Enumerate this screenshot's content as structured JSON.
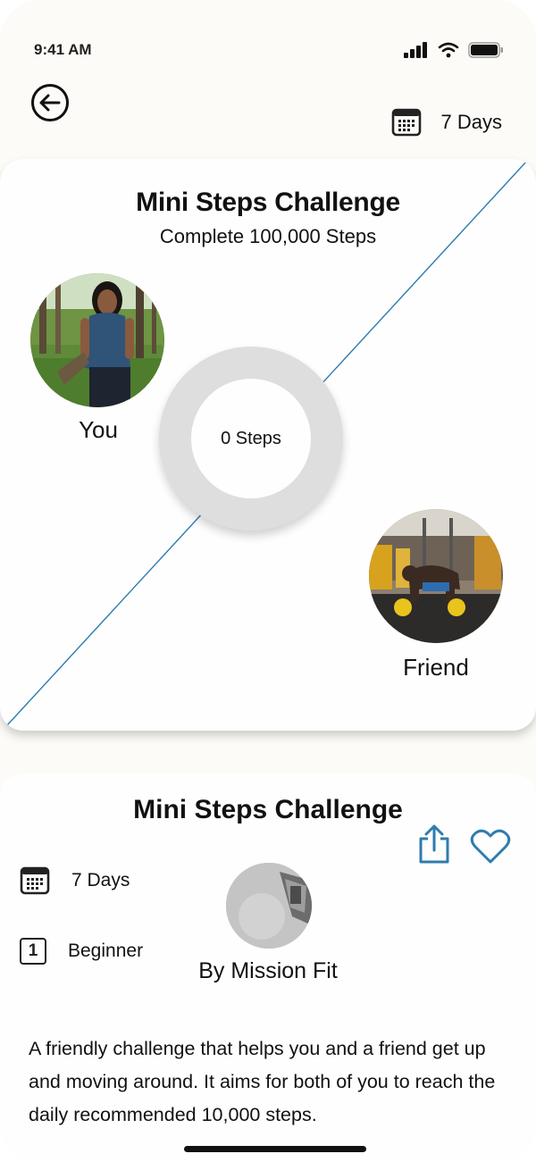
{
  "status_bar": {
    "time": "9:41 AM"
  },
  "header": {
    "duration": "7 Days"
  },
  "challenge_card": {
    "title": "Mini Steps Challenge",
    "subtitle": "Complete 100,000 Steps",
    "progress_label": "0 Steps",
    "participants": [
      {
        "name": "You"
      },
      {
        "name": "Friend"
      }
    ]
  },
  "details": {
    "title": "Mini Steps Challenge",
    "duration": "7 Days",
    "level_number": "1",
    "level": "Beginner",
    "author": "By Mission Fit",
    "description": "A friendly challenge that helps you and a friend get up and moving around. It aims for both of you to reach the daily recommended 10,000 steps."
  },
  "colors": {
    "accent": "#2e7cae",
    "ring": "#dedede",
    "background": "#fcfbf7"
  }
}
